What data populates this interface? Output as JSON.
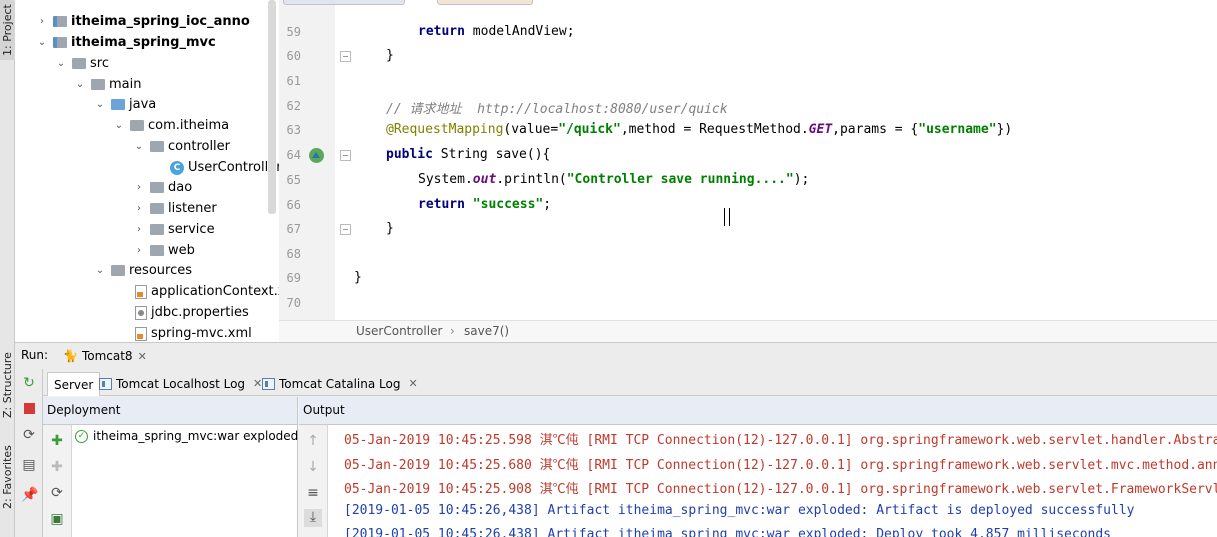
{
  "left_strip": {
    "project_tab": "1: Project",
    "structure_tab": "Z: Structure",
    "favorites_tab": "2: Favorites"
  },
  "tree": {
    "items": [
      {
        "label": "itheima_spring_ioc_anno",
        "arrow": "›",
        "icon": "module-folder-icon"
      },
      {
        "label": "itheima_spring_mvc",
        "arrow": "⌄",
        "icon": "module-folder-icon"
      },
      {
        "label": "src",
        "arrow": "⌄",
        "icon": "folder-icon"
      },
      {
        "label": "main",
        "arrow": "⌄",
        "icon": "folder-icon"
      },
      {
        "label": "java",
        "arrow": "⌄",
        "icon": "source-folder-icon"
      },
      {
        "label": "com.itheima",
        "arrow": "⌄",
        "icon": "package-icon"
      },
      {
        "label": "controller",
        "arrow": "⌄",
        "icon": "package-icon"
      },
      {
        "label": "UserController",
        "arrow": "",
        "icon": "class-icon"
      },
      {
        "label": "dao",
        "arrow": "›",
        "icon": "package-icon"
      },
      {
        "label": "listener",
        "arrow": "›",
        "icon": "package-icon"
      },
      {
        "label": "service",
        "arrow": "›",
        "icon": "package-icon"
      },
      {
        "label": "web",
        "arrow": "›",
        "icon": "package-icon"
      },
      {
        "label": "resources",
        "arrow": "⌄",
        "icon": "resources-folder-icon"
      },
      {
        "label": "applicationContext.xml",
        "arrow": "",
        "icon": "xml-file-icon"
      },
      {
        "label": "jdbc.properties",
        "arrow": "",
        "icon": "properties-file-icon"
      },
      {
        "label": "spring-mvc.xml",
        "arrow": "",
        "icon": "xml-file-icon"
      }
    ],
    "class_badge": "C"
  },
  "editor": {
    "line_numbers": [
      "59",
      "60",
      "61",
      "62",
      "63",
      "64",
      "65",
      "66",
      "67",
      "68",
      "69",
      "70"
    ],
    "code": {
      "l59_kw": "return",
      "l59_rest": " modelAndView;",
      "l60": "}",
      "l62_comment": "// 请求地址  http://localhost:8080/user/quick",
      "l63_ann": "@RequestMapping",
      "l63_a": "(value=",
      "l63_s1": "\"/quick\"",
      "l63_b": ",method = RequestMethod.",
      "l63_get": "GET",
      "l63_c": ",params = {",
      "l63_s2": "\"username\"",
      "l63_d": "})",
      "l64_kw": "public",
      "l64_rest": " String save(){",
      "l65_a": "System.",
      "l65_out": "out",
      "l65_b": ".println(",
      "l65_s": "\"Controller save running....\"",
      "l65_c": ");",
      "l66_kw": "return",
      "l66_sp": " ",
      "l66_s": "\"success\"",
      "l66_c": ";",
      "l67": "}",
      "l69": "}"
    },
    "breadcrumb": {
      "class_name": "UserController",
      "separator": "›",
      "method": "save7()"
    }
  },
  "run": {
    "label": "Run:",
    "config": "Tomcat8",
    "tabs": [
      {
        "label": "Server"
      },
      {
        "label": "Tomcat Localhost Log"
      },
      {
        "label": "Tomcat Catalina Log"
      }
    ],
    "deployment_header": "Deployment",
    "output_header": "Output",
    "deployment_item": "itheima_spring_mvc:war exploded",
    "output_lines": [
      "05-Jan-2019 10:45:25.598 淇℃伅 [RMI TCP Connection(12)-127.0.0.1] org.springframework.web.servlet.handler.AbstractHandlerMethodMapping",
      "05-Jan-2019 10:45:25.680 淇℃伅 [RMI TCP Connection(12)-127.0.0.1] org.springframework.web.servlet.mvc.method.annotation",
      "05-Jan-2019 10:45:25.908 淇℃伅 [RMI TCP Connection(12)-127.0.0.1] org.springframework.web.servlet.FrameworkServlet",
      "[2019-01-05 10:45:26,438] Artifact itheima_spring_mvc:war exploded: Artifact is deployed successfully",
      "[2019-01-05 10:45:26,438] Artifact itheima_spring_mvc:war exploded: Deploy took 4,857 milliseconds"
    ]
  },
  "colors": {
    "keyword": "#000080",
    "string": "#008000",
    "comment": "#808080",
    "annotation": "#808000",
    "log_red": "#c0392b",
    "log_blue": "#1f3fb0"
  }
}
